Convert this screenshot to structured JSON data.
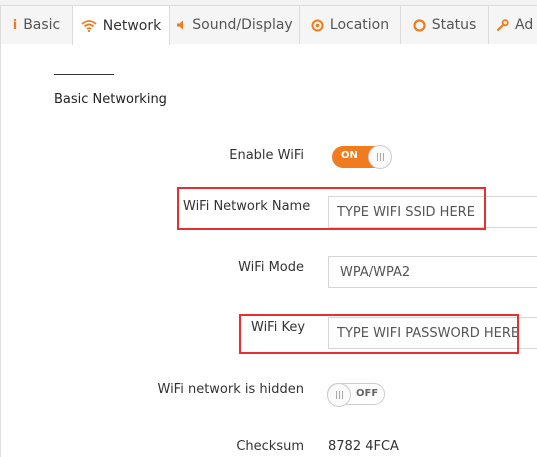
{
  "tabs": [
    {
      "label": "Basic",
      "icon": "info-icon",
      "glyph": "i"
    },
    {
      "label": "Network",
      "icon": "wifi-icon"
    },
    {
      "label": "Sound/Display",
      "icon": "speaker-icon"
    },
    {
      "label": "Location",
      "icon": "location-target-icon"
    },
    {
      "label": "Status",
      "icon": "status-ring-icon"
    },
    {
      "label": "Ad",
      "icon": "wrench-icon"
    }
  ],
  "active_tab": "Network",
  "section": {
    "title": "Basic Networking"
  },
  "fields": {
    "enable_wifi": {
      "label": "Enable WiFi",
      "state": "ON"
    },
    "wifi_network_name": {
      "label": "WiFi Network Name",
      "placeholder": "TYPE WIFI SSID HERE"
    },
    "wifi_mode": {
      "label": "WiFi Mode",
      "value": "WPA/WPA2"
    },
    "wifi_key": {
      "label": "WiFi Key",
      "placeholder": "TYPE WIFI PASSWORD HERE"
    },
    "wifi_hidden": {
      "label": "WiFi network is hidden",
      "state": "OFF"
    },
    "checksum": {
      "label": "Checksum",
      "value": "8782 4FCA"
    }
  },
  "colors": {
    "accent": "#f07c1f",
    "highlight": "#e5302f"
  }
}
